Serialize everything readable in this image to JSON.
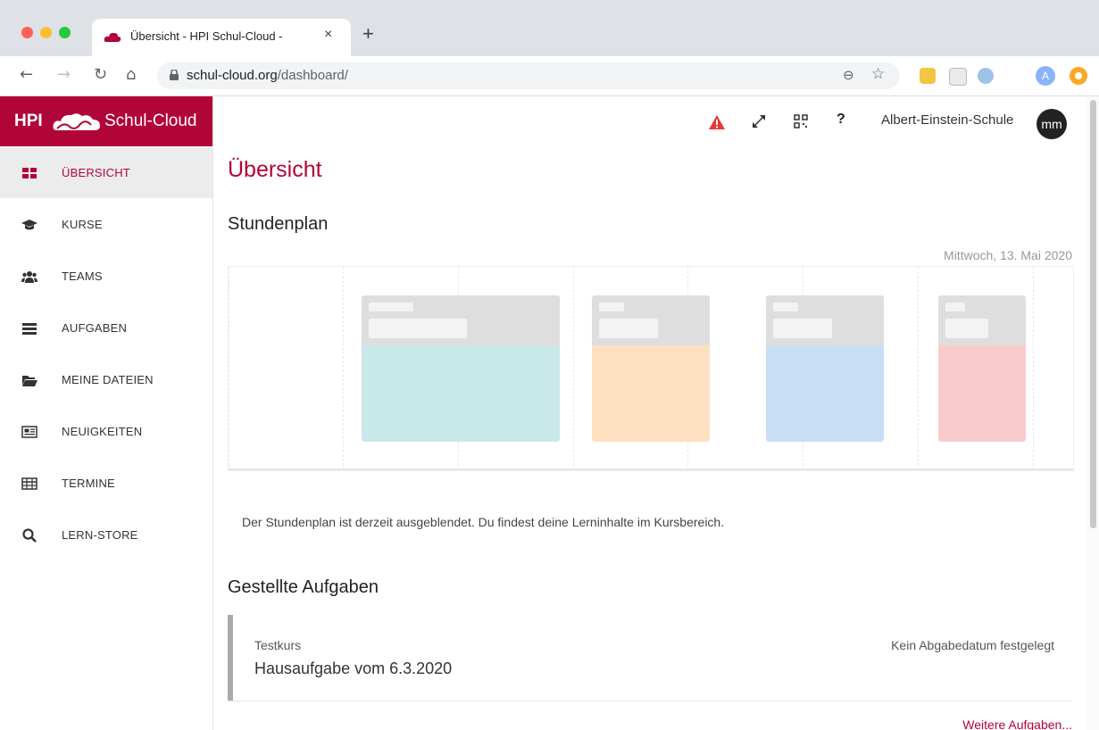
{
  "browser": {
    "tab_title": "Übersicht - HPI Schul-Cloud -",
    "tab_close": "×",
    "new_tab": "+",
    "url_host": "schul-cloud.org",
    "url_path": "/dashboard/",
    "profile_initial": "A"
  },
  "brand": {
    "prefix": "HPI",
    "name": "Schul-Cloud",
    "color": "#b10438"
  },
  "sidebar": {
    "items": [
      {
        "label": "ÜBERSICHT",
        "icon": "dashboard-icon",
        "active": true
      },
      {
        "label": "KURSE",
        "icon": "graduation-cap-icon"
      },
      {
        "label": "TEAMS",
        "icon": "users-icon"
      },
      {
        "label": "AUFGABEN",
        "icon": "tasks-icon"
      },
      {
        "label": "MEINE DATEIEN",
        "icon": "folder-icon"
      },
      {
        "label": "NEUIGKEITEN",
        "icon": "newspaper-icon"
      },
      {
        "label": "TERMINE",
        "icon": "calendar-icon"
      },
      {
        "label": "LERN-STORE",
        "icon": "search-icon"
      }
    ]
  },
  "header": {
    "help": "?",
    "school": "Albert-Einstein-Schule",
    "user_initials": "mm"
  },
  "main": {
    "title": "Übersicht",
    "timetable_title": "Stundenplan",
    "date": "Mittwoch, 13. Mai 2020",
    "timetable_hint": "Der Stundenplan ist derzeit ausgeblendet. Du findest deine Lerninhalte im Kursbereich.",
    "lesson_colors": [
      "#c9e8ea",
      "#fde0c2",
      "#c7def5",
      "#f8cccc"
    ],
    "tasks_title": "Gestellte Aufgaben",
    "task": {
      "course": "Testkurs",
      "name": "Hausaufgabe vom 6.3.2020",
      "due": "Kein Abgabedatum festgelegt"
    },
    "more_tasks": "Weitere Aufgaben..."
  }
}
